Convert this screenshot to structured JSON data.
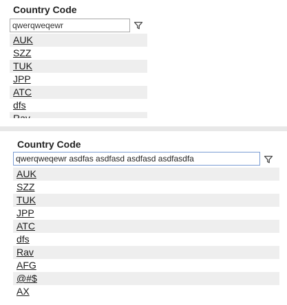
{
  "top_panel": {
    "title": "Country Code",
    "search_value": "qwerqweqewr",
    "items": [
      "AUK",
      "SZZ",
      "TUK",
      "JPP",
      "ATC",
      "dfs",
      "Rav"
    ]
  },
  "bottom_panel": {
    "title": "Country Code",
    "search_value": "qwerqweqewr asdfas asdfasd asdfasd asdfasdfa",
    "items": [
      "AUK",
      "SZZ",
      "TUK",
      "JPP",
      "ATC",
      "dfs",
      "Rav",
      "AFG",
      "@#$",
      "AX"
    ]
  },
  "icons": {
    "filter": "filter-icon"
  }
}
